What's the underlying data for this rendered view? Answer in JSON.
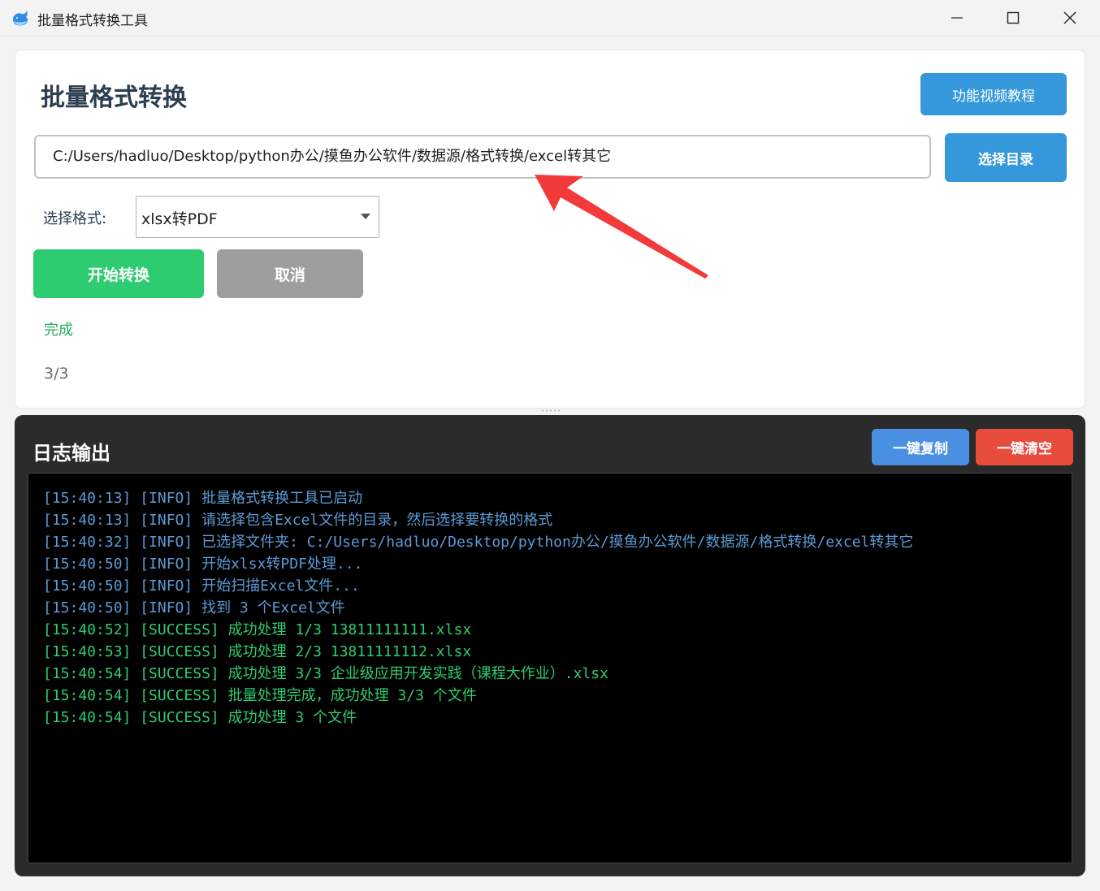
{
  "window": {
    "title": "批量格式转换工具",
    "icon": "whale-icon",
    "controls": [
      "minimize-icon",
      "maximize-icon",
      "close-icon"
    ]
  },
  "header": {
    "title": "批量格式转换",
    "tutorial_button": "功能视频教程"
  },
  "directory": {
    "path_value": "C:/Users/hadluo/Desktop/python办公/摸鱼办公软件/数据源/格式转换/excel转其它",
    "choose_button": "选择目录"
  },
  "format": {
    "label": "选择格式:",
    "selected": "xlsx转PDF"
  },
  "actions": {
    "start_button": "开始转换",
    "cancel_button": "取消"
  },
  "status": {
    "message": "完成",
    "progress": "3/3"
  },
  "log": {
    "title": "日志输出",
    "copy_button": "一键复制",
    "clear_button": "一键清空",
    "lines": [
      {
        "level": "info",
        "text": "[15:40:13] [INFO] 批量格式转换工具已启动"
      },
      {
        "level": "info",
        "text": "[15:40:13] [INFO] 请选择包含Excel文件的目录，然后选择要转换的格式"
      },
      {
        "level": "info",
        "text": "[15:40:32] [INFO] 已选择文件夹: C:/Users/hadluo/Desktop/python办公/摸鱼办公软件/数据源/格式转换/excel转其它"
      },
      {
        "level": "info",
        "text": "[15:40:50] [INFO] 开始xlsx转PDF处理..."
      },
      {
        "level": "info",
        "text": "[15:40:50] [INFO] 开始扫描Excel文件..."
      },
      {
        "level": "info",
        "text": "[15:40:50] [INFO] 找到 3 个Excel文件"
      },
      {
        "level": "success",
        "text": "[15:40:52] [SUCCESS] 成功处理 1/3 13811111111.xlsx"
      },
      {
        "level": "success",
        "text": "[15:40:53] [SUCCESS] 成功处理 2/3 13811111112.xlsx"
      },
      {
        "level": "success",
        "text": "[15:40:54] [SUCCESS] 成功处理 3/3 企业级应用开发实践（课程大作业）.xlsx"
      },
      {
        "level": "success",
        "text": "[15:40:54] [SUCCESS] 批量处理完成，成功处理 3/3 个文件"
      },
      {
        "level": "success",
        "text": "[15:40:54] [SUCCESS] 成功处理 3 个文件"
      }
    ]
  },
  "colors": {
    "accent_blue": "#3498db",
    "start_green": "#2ecc71",
    "cancel_gray": "#9e9e9e",
    "clear_red": "#e74c3c",
    "copy_blue": "#4a90e2",
    "info_text": "#5b9bd5",
    "success_text": "#2ecc71",
    "annotation_red": "#f23a3a"
  }
}
